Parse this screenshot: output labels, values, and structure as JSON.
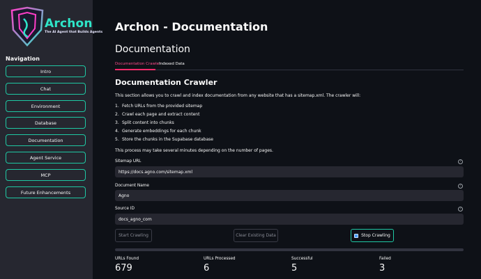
{
  "sidebar": {
    "logo_text": "Archon",
    "logo_tagline": "The AI Agent that Builds Agents",
    "nav_title": "Navigation",
    "items": [
      "Intro",
      "Chat",
      "Environment",
      "Database",
      "Documentation",
      "Agent Service",
      "MCP",
      "Future Enhancements"
    ]
  },
  "main": {
    "title": "Archon - Documentation",
    "section_title": "Documentation",
    "tabs": [
      {
        "label": "Documentation Crawler",
        "active": true
      },
      {
        "label": "Indexed Data",
        "active": false
      }
    ],
    "crawler_title": "Documentation Crawler",
    "intro": "This section allows you to crawl and index documentation from any website that has a sitemap.xml. The crawler will:",
    "steps": [
      "Fetch URLs from the provided sitemap",
      "Crawl each page and extract content",
      "Split content into chunks",
      "Generate embeddings for each chunk",
      "Store the chunks in the Supabase database"
    ],
    "note": "This process may take several minutes depending on the number of pages.",
    "fields": {
      "sitemap": {
        "label": "Sitemap URL",
        "value": "https://docs.agno.com/sitemap.xml"
      },
      "docname": {
        "label": "Document Name",
        "value": "Agno"
      },
      "source": {
        "label": "Source ID",
        "value": "docs_agno_com"
      }
    },
    "buttons": {
      "start": "Start Crawling",
      "clear": "Clear Existing Data",
      "stop": "Stop Crawling"
    },
    "stats": [
      {
        "label": "URLs Found",
        "value": "679"
      },
      {
        "label": "URLs Processed",
        "value": "6"
      },
      {
        "label": "Successful",
        "value": "5"
      },
      {
        "label": "Failed",
        "value": "3"
      }
    ],
    "progress_fraction": 0.0088
  },
  "colors": {
    "accent": "#1fc9a4",
    "tab_active": "#ff2b6b",
    "bg": "#0e1117",
    "sidebar": "#262730"
  }
}
